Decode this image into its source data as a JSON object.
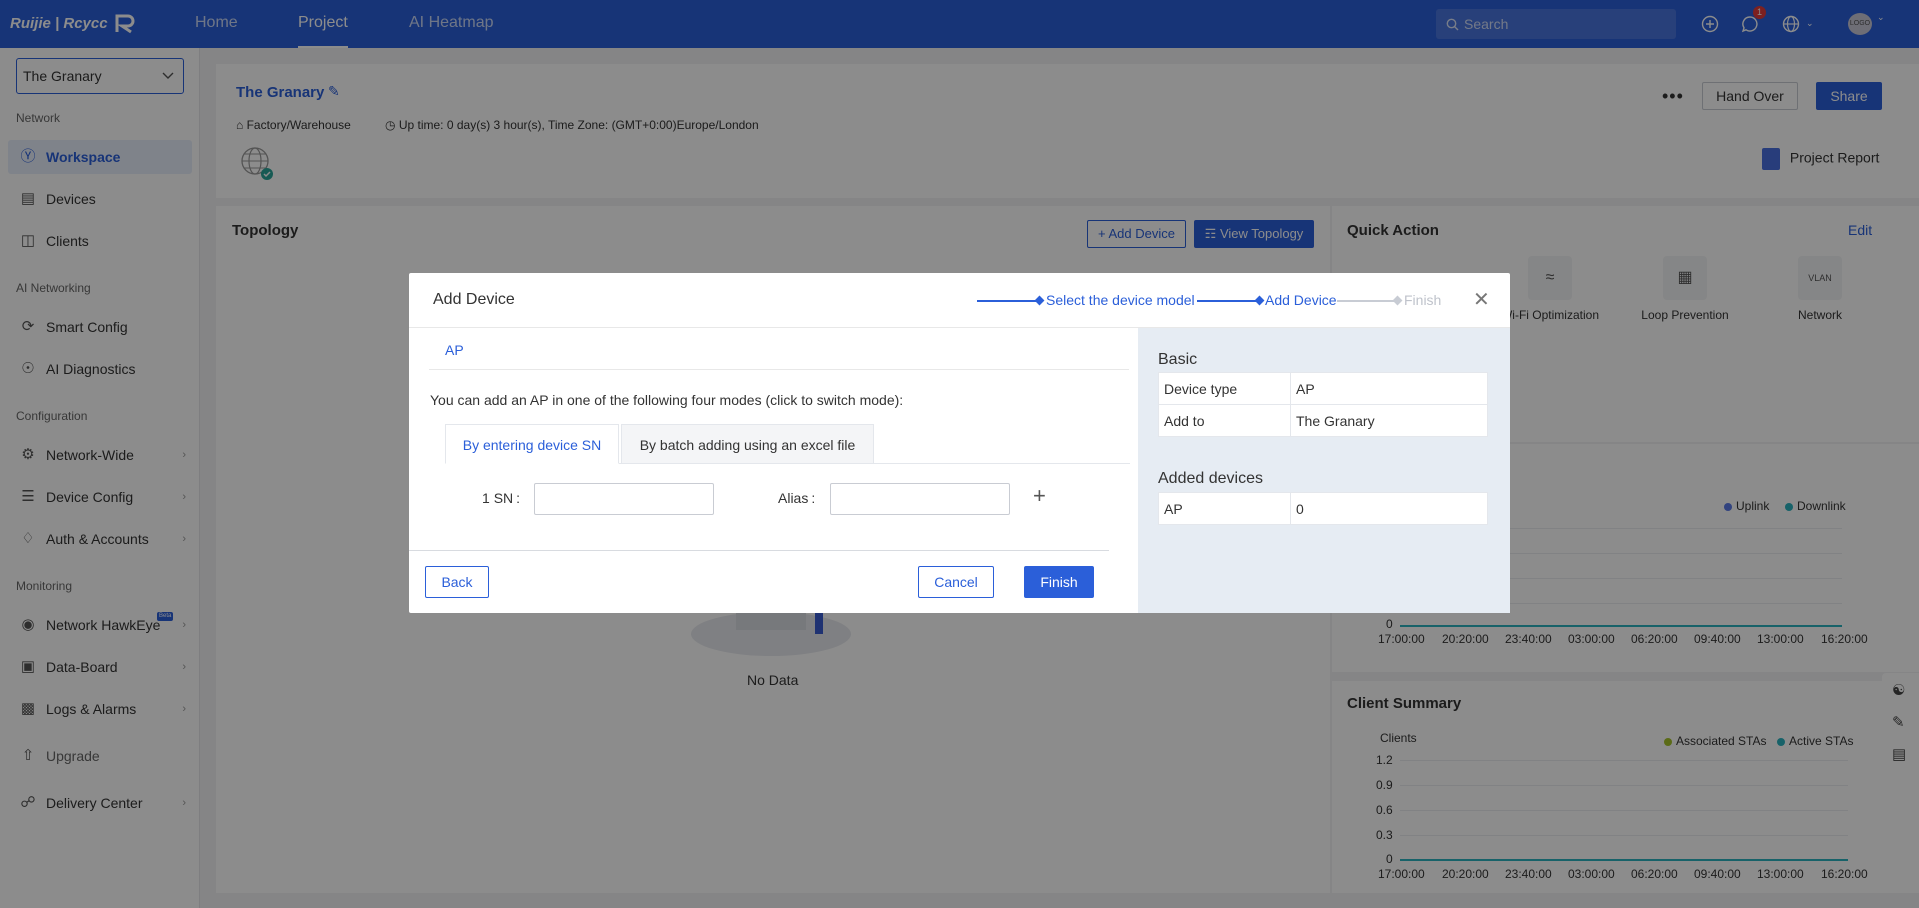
{
  "topbar": {
    "brand": "Ruijie | Rcycc",
    "nav": [
      "Home",
      "Project",
      "AI Heatmap"
    ],
    "search_placeholder": "Search",
    "notification_count": "1",
    "avatar_text": "LOGO"
  },
  "sidebar": {
    "project": "The Granary",
    "sections": {
      "network": "Network",
      "ai": "AI Networking",
      "config": "Configuration",
      "monitoring": "Monitoring"
    },
    "items": {
      "workspace": "Workspace",
      "devices": "Devices",
      "clients": "Clients",
      "smart_config": "Smart Config",
      "ai_diagnostics": "AI Diagnostics",
      "network_wide": "Network-Wide",
      "device_config": "Device Config",
      "auth_accounts": "Auth & Accounts",
      "network_hawkeye": "Network HawkEye",
      "hawkeye_badge": "Beta",
      "data_board": "Data-Board",
      "logs_alarms": "Logs & Alarms",
      "upgrade": "Upgrade",
      "delivery_center": "Delivery Center"
    }
  },
  "project_header": {
    "name": "The Granary",
    "type": "Factory/Warehouse",
    "uptime": "Up time: 0 day(s) 3 hour(s), Time Zone: (GMT+0:00)Europe/London",
    "hand_over": "Hand Over",
    "share": "Share",
    "project_report": "Project Report"
  },
  "topology": {
    "title": "Topology",
    "add_device": "Add Device",
    "view_topology": "View Topology",
    "empty": "No Data"
  },
  "quick_action": {
    "title": "Quick Action",
    "edit": "Edit",
    "items": [
      "Wi-Fi Optimization",
      "Loop Prevention",
      "Network"
    ]
  },
  "traffic_chart": {
    "legend": [
      "Uplink",
      "Downlink"
    ],
    "colors": {
      "uplink": "#5b7be8",
      "downlink": "#2bb3c0"
    },
    "y_ticks": [
      "0"
    ],
    "x_ticks": [
      "17:00:00",
      "20:20:00",
      "23:40:00",
      "03:00:00",
      "06:20:00",
      "09:40:00",
      "13:00:00",
      "16:20:00"
    ]
  },
  "client_summary": {
    "title": "Client Summary",
    "ylabel": "Clients",
    "legend": [
      "Associated STAs",
      "Active STAs"
    ],
    "colors": {
      "associated": "#a7c42a",
      "active": "#2bb3c0"
    },
    "y_ticks": [
      "1.2",
      "0.9",
      "0.6",
      "0.3",
      "0"
    ],
    "x_ticks": [
      "17:00:00",
      "20:20:00",
      "23:40:00",
      "03:00:00",
      "06:20:00",
      "09:40:00",
      "13:00:00",
      "16:20:00"
    ]
  },
  "modal": {
    "title": "Add Device",
    "steps": [
      "Select the device model",
      "Add Device",
      "Finish"
    ],
    "device_tab": "AP",
    "instructions": "You can add an AP in one of the following four modes (click to switch mode):",
    "mode_tabs": [
      "By entering device SN",
      "By batch adding using an excel file"
    ],
    "row_index": "1",
    "sn_label": "SN",
    "alias_label": "Alias",
    "sn_value": "",
    "alias_value": "",
    "back": "Back",
    "cancel": "Cancel",
    "finish": "Finish",
    "basic_title": "Basic",
    "basic_rows": [
      {
        "label": "Device type",
        "value": "AP"
      },
      {
        "label": "Add to",
        "value": "The Granary"
      }
    ],
    "added_title": "Added devices",
    "added_rows": [
      {
        "label": "AP",
        "value": "0"
      }
    ]
  }
}
